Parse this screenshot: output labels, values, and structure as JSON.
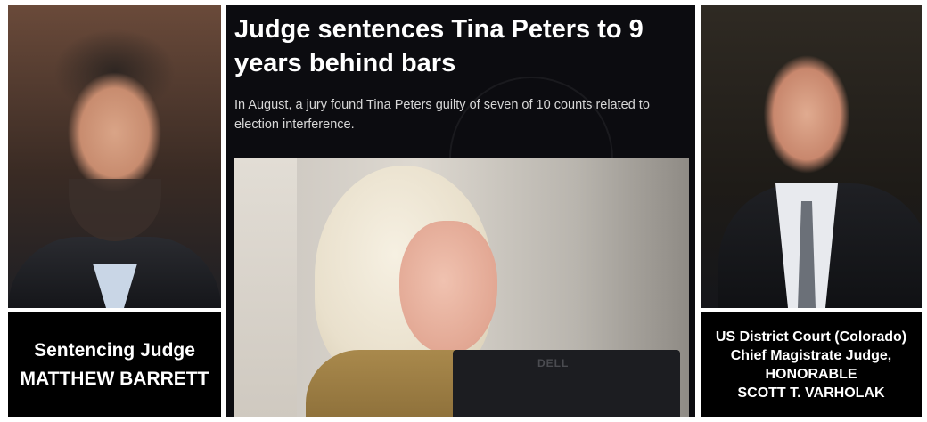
{
  "left": {
    "caption_line1": "Sentencing Judge",
    "caption_line2": "MATTHEW BARRETT"
  },
  "center": {
    "headline": "Judge sentences Tina Peters to 9 years behind bars",
    "subtext": "In August, a jury found Tina Peters guilty of seven of 10 counts related to election interference.",
    "monitor_brand": "DELL"
  },
  "right": {
    "caption_lines": [
      "US District Court (Colorado)",
      "Chief Magistrate Judge,",
      "HONORABLE",
      "SCOTT T. VARHOLAK"
    ]
  },
  "colors": {
    "caption_bg": "#000000",
    "caption_text": "#ffffff",
    "headline_bg": "#0c0c10"
  }
}
